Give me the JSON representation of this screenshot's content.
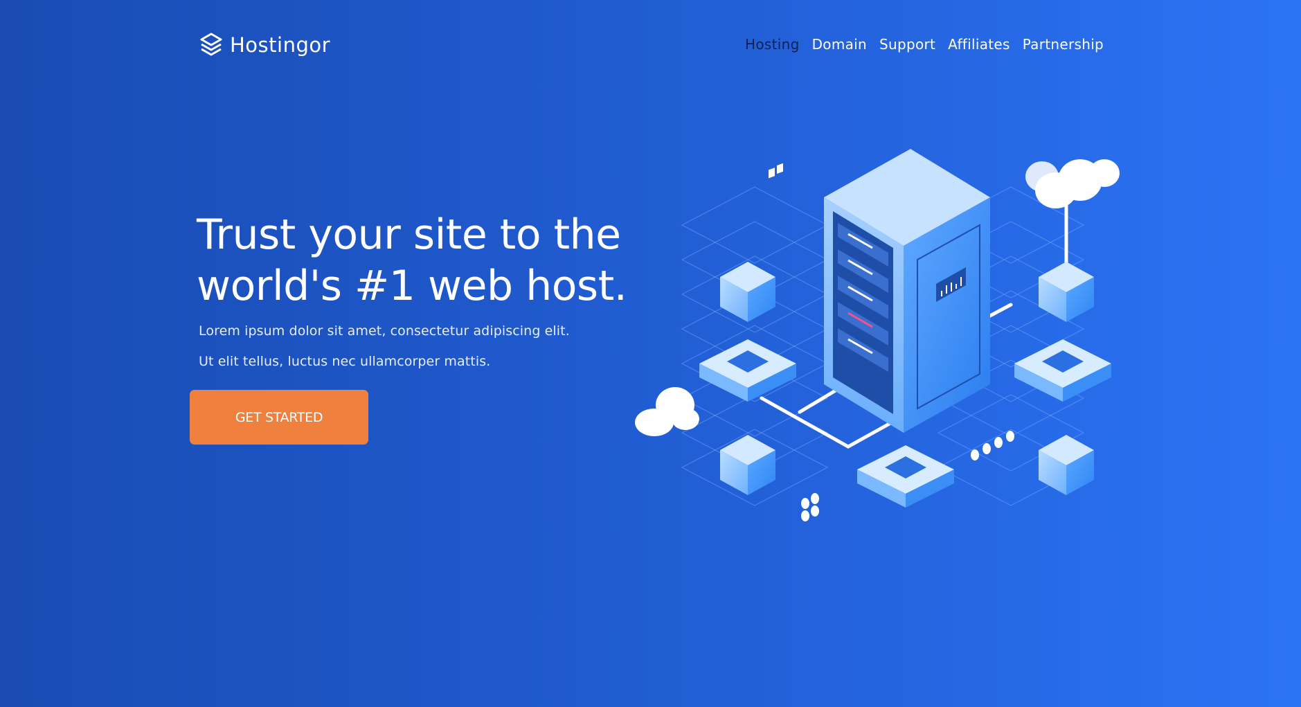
{
  "brand": {
    "name": "Hostingor",
    "icon": "layers-logo-icon"
  },
  "nav": {
    "items": [
      {
        "label": "Hosting",
        "active": true
      },
      {
        "label": "Domain",
        "active": false
      },
      {
        "label": "Support",
        "active": false
      },
      {
        "label": "Affiliates",
        "active": false
      },
      {
        "label": "Partnership",
        "active": false
      }
    ]
  },
  "hero": {
    "title": "Trust your site to the world's #1 web host.",
    "line1": "Lorem ipsum dolor sit amet, consectetur adipiscing elit.",
    "line2": "Ut elit tellus, luctus nec ullamcorper mattis.",
    "cta_label": "GET STARTED"
  },
  "colors": {
    "accent": "#ef803d",
    "bg_start": "#1a4cb3",
    "bg_end": "#2b74f5",
    "nav_active": "#0e2152"
  }
}
